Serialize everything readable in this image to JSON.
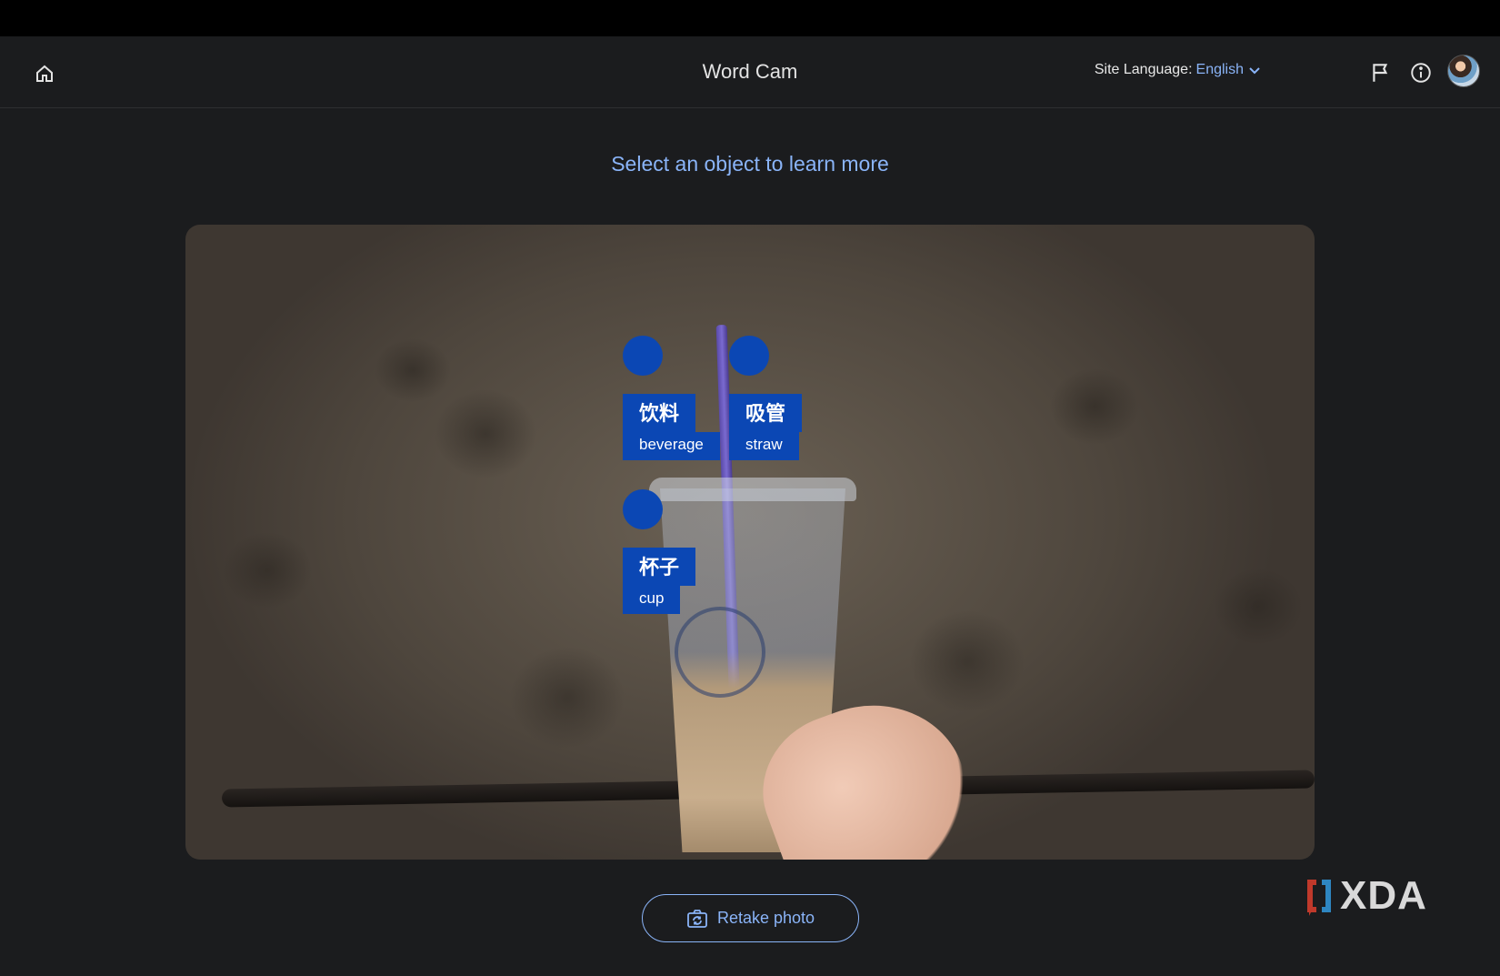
{
  "header": {
    "title": "Word Cam",
    "site_language_label": "Site Language:",
    "site_language_value": "English",
    "icons": {
      "home": "home-icon",
      "language_dropdown": "chevron-down-icon",
      "report": "flag-icon",
      "info": "info-icon"
    }
  },
  "main": {
    "prompt": "Select an object to learn more",
    "labels": [
      {
        "target": "Chinese",
        "native": "饮料",
        "english": "beverage"
      },
      {
        "target": "Chinese",
        "native": "吸管",
        "english": "straw"
      },
      {
        "target": "Chinese",
        "native": "杯子",
        "english": "cup"
      }
    ],
    "retake_label": "Retake photo",
    "retake_icon": "camera-flip-icon"
  },
  "watermark": {
    "text": "XDA"
  },
  "colors": {
    "accent": "#8ab4f8",
    "label_bg": "#0b47b4",
    "background": "#1b1c1e"
  }
}
